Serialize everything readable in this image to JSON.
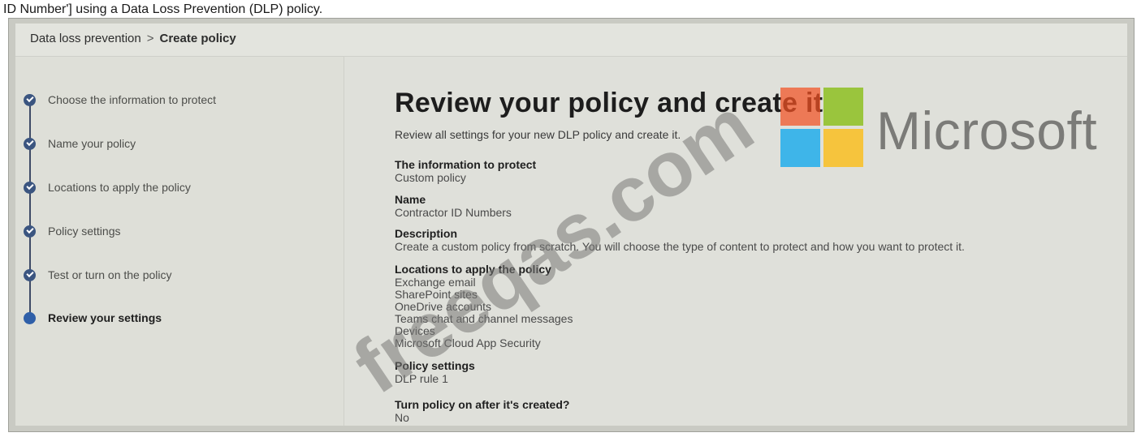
{
  "caption": "ID Number'] using a Data Loss Prevention (DLP) policy.",
  "breadcrumb": {
    "parent": "Data loss prevention",
    "separator": ">",
    "current": "Create policy"
  },
  "steps": [
    {
      "label": "Choose the information to protect",
      "status": "completed"
    },
    {
      "label": "Name your policy",
      "status": "completed"
    },
    {
      "label": "Locations to apply the policy",
      "status": "completed"
    },
    {
      "label": "Policy settings",
      "status": "completed"
    },
    {
      "label": "Test or turn on the policy",
      "status": "completed"
    },
    {
      "label": "Review your settings",
      "status": "current"
    }
  ],
  "main": {
    "title": "Review your policy and create it",
    "intro": "Review all settings for your new DLP policy and create it.",
    "information_heading": "The information to protect",
    "information_value": "Custom policy",
    "name_heading": "Name",
    "name_value": "Contractor ID Numbers",
    "description_heading": "Description",
    "description_value": "Create a custom policy from scratch. You will choose the type of content to protect and how you want to protect it.",
    "locations_heading": "Locations to apply the policy",
    "locations": [
      "Exchange email",
      "SharePoint sites",
      "OneDrive accounts",
      "Teams chat and channel messages",
      "Devices",
      "Microsoft Cloud App Security"
    ],
    "policy_settings_heading": "Policy settings",
    "policy_settings_value": "DLP rule 1",
    "turn_on_heading": "Turn policy on after it's created?",
    "turn_on_value": "No"
  },
  "watermark_text": "freeqas.com",
  "logo": {
    "wordmark": "Microsoft",
    "colors": [
      "#f25022",
      "#7fba00",
      "#00a4ef",
      "#ffb900"
    ]
  },
  "colors": {
    "step_active": "#2f5fa8",
    "step_done": "#3b5580",
    "panel_background": "#dfe0da"
  }
}
